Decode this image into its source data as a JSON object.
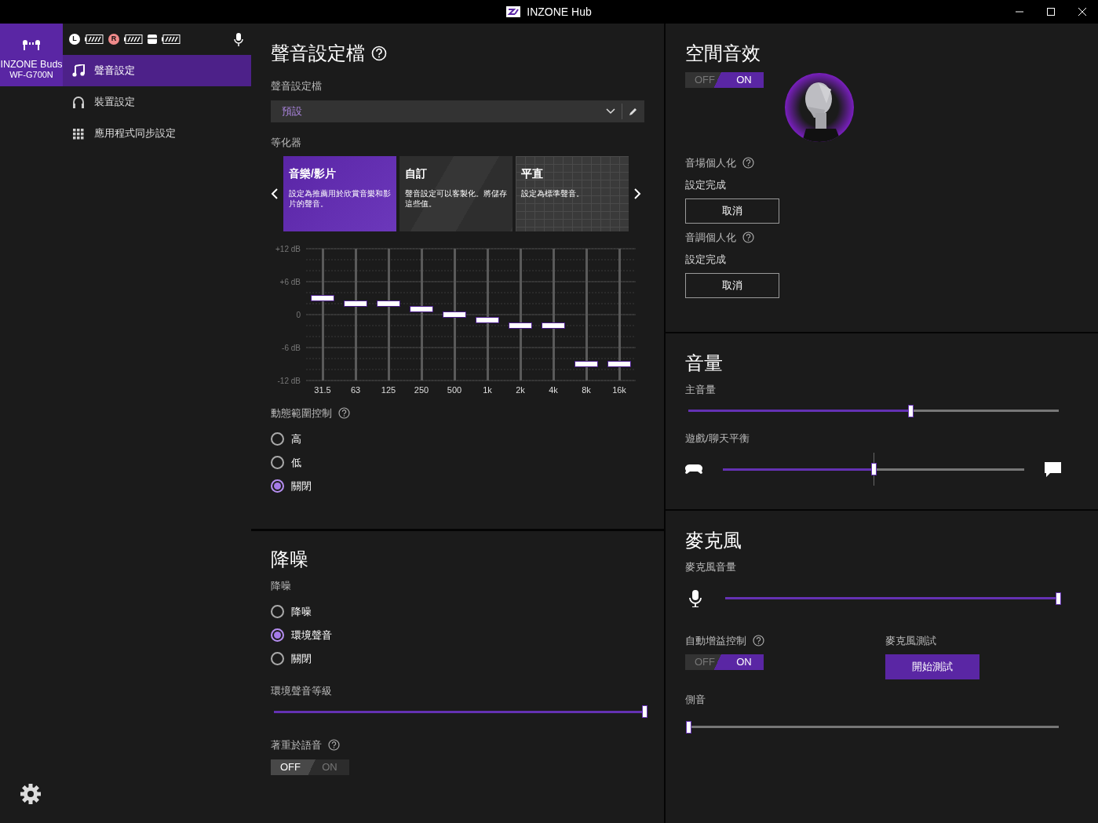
{
  "window": {
    "title": "INZONE Hub"
  },
  "device": {
    "name": "INZONE Buds",
    "model": "WF-G700N"
  },
  "battery_status": [
    {
      "kind": "earbud",
      "label": "L",
      "color": "#ffffff"
    },
    {
      "kind": "earbud",
      "label": "R",
      "color": "#f08a8a"
    },
    {
      "kind": "case"
    }
  ],
  "nav": [
    {
      "kind": "music",
      "label": "聲音設定",
      "selected": true
    },
    {
      "kind": "headphones",
      "label": "裝置設定",
      "selected": false
    },
    {
      "kind": "apps",
      "label": "應用程式同步設定",
      "selected": false
    }
  ],
  "sound_profile": {
    "title": "聲音設定檔",
    "label": "聲音設定檔",
    "value": "預設"
  },
  "equalizer": {
    "label": "等化器",
    "presets": [
      {
        "kind": "music",
        "title": "音樂/影片",
        "description": "設定為推薦用於欣賞音樂和影片的聲音。",
        "selected": true
      },
      {
        "kind": "custom",
        "title": "自訂",
        "description": "聲音設定可以客製化。將儲存這些值。",
        "selected": false
      },
      {
        "kind": "flat",
        "title": "平直",
        "description": "設定為標準聲音。",
        "selected": false
      }
    ],
    "scale_labels": [
      "+12 dB",
      "+6 dB",
      "0",
      "-6 dB",
      "-12 dB"
    ],
    "bands": [
      {
        "label": "31.5",
        "level": 0.625
      },
      {
        "label": "63",
        "level": 0.5833
      },
      {
        "label": "125",
        "level": 0.5833
      },
      {
        "label": "250",
        "level": 0.5417
      },
      {
        "label": "500",
        "level": 0.5
      },
      {
        "label": "1k",
        "level": 0.4583
      },
      {
        "label": "2k",
        "level": 0.4167
      },
      {
        "label": "4k",
        "level": 0.4167
      },
      {
        "label": "8k",
        "level": 0.125
      },
      {
        "label": "16k",
        "level": 0.125
      }
    ]
  },
  "dynamic_range": {
    "label": "動態範圍控制",
    "options": [
      {
        "label": "高",
        "selected": false
      },
      {
        "label": "低",
        "selected": false
      },
      {
        "label": "關閉",
        "selected": true
      }
    ]
  },
  "noise_control": {
    "title": "降噪",
    "label": "降噪",
    "options": [
      {
        "label": "降噪",
        "selected": false
      },
      {
        "label": "環境聲音",
        "selected": true
      },
      {
        "label": "關閉",
        "selected": false
      }
    ],
    "ambient": {
      "label": "環境聲音等級",
      "level": 1
    },
    "focus_voice": {
      "label": "著重於語音",
      "on": false,
      "off_text": "OFF",
      "on_text": "ON"
    }
  },
  "spatial": {
    "title": "空間音效",
    "toggle": {
      "on": true,
      "off_text": "OFF",
      "on_text": "ON"
    },
    "personalizations": [
      {
        "label": "音場個人化",
        "status": "設定完成",
        "button": "取消"
      },
      {
        "label": "音調個人化",
        "status": "設定完成",
        "button": "取消"
      }
    ]
  },
  "volume": {
    "title": "音量",
    "master": {
      "label": "主音量",
      "level": 0.6
    },
    "balance": {
      "label": "遊戲/聊天平衡",
      "level": 0.5
    }
  },
  "microphone": {
    "title": "麥克風",
    "volume": {
      "label": "麥克風音量",
      "level": 1
    },
    "agc": {
      "label": "自動增益控制",
      "on": true,
      "off_text": "OFF",
      "on_text": "ON"
    },
    "test": {
      "label": "麥克風測試",
      "button": "開始測試"
    },
    "sidetone": {
      "label": "側音",
      "level": 0
    }
  }
}
